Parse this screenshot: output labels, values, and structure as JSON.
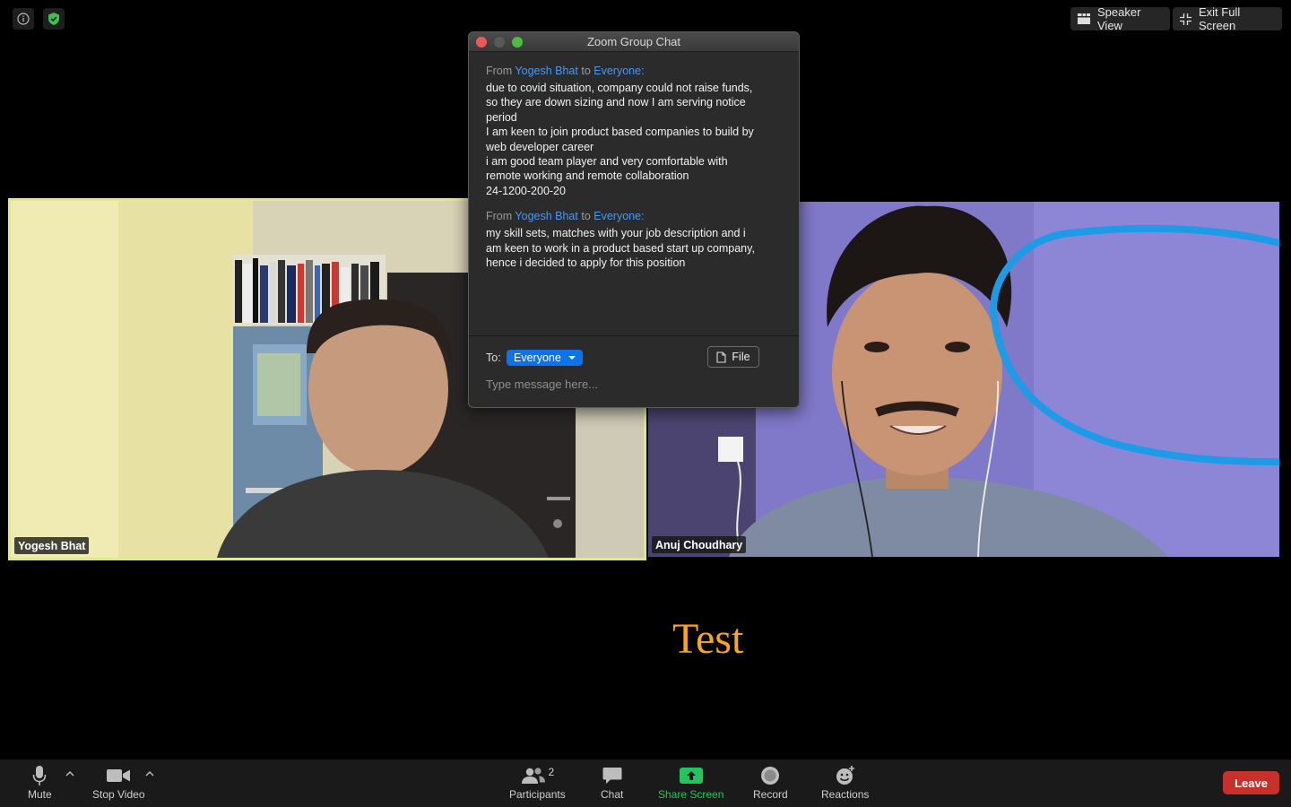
{
  "top_right": {
    "speaker_view_label": "Speaker View",
    "exit_fullscreen_label": "Exit Full Screen"
  },
  "participants_tiles": [
    {
      "name": "Yogesh Bhat",
      "active_speaker": true
    },
    {
      "name": "Anuj Choudhary",
      "active_speaker": false
    }
  ],
  "chat": {
    "window_title": "Zoom Group Chat",
    "messages": [
      {
        "from_word": "From",
        "sender": "Yogesh Bhat",
        "to_word": "to",
        "recipient": "Everyone:",
        "lines": [
          "due to covid situation, company could not raise funds,",
          "so they are down sizing and now I am serving notice",
          "period",
          "I am keen to join product based companies to build by",
          "web developer career",
          "i am good team player and very comfortable with",
          "remote working and remote collaboration",
          "24-1200-200-20"
        ]
      },
      {
        "from_word": "From",
        "sender": "Yogesh Bhat",
        "to_word": "to",
        "recipient": "Everyone:",
        "lines": [
          "my skill sets, matches with your job description and i",
          "am keen to work in a product based start up company,",
          "hence i decided to apply for this position"
        ]
      }
    ],
    "to_label": "To:",
    "recipient_selected": "Everyone",
    "file_button_label": "File",
    "input_placeholder": "Type message here..."
  },
  "annotation_text": "Test",
  "toolbar": {
    "mute_label": "Mute",
    "stop_video_label": "Stop Video",
    "participants_label": "Participants",
    "participants_count": "2",
    "chat_label": "Chat",
    "share_screen_label": "Share Screen",
    "record_label": "Record",
    "reactions_label": "Reactions",
    "leave_label": "Leave"
  },
  "colors": {
    "accent_blue": "#0e72ed",
    "sender_blue": "#4c97f0",
    "share_green": "#22c55e",
    "leave_red": "#c7302b",
    "active_speaker_border": "#dfe88a",
    "annotation_orange": "#f5a623",
    "shield_green": "#3fbf4f"
  }
}
